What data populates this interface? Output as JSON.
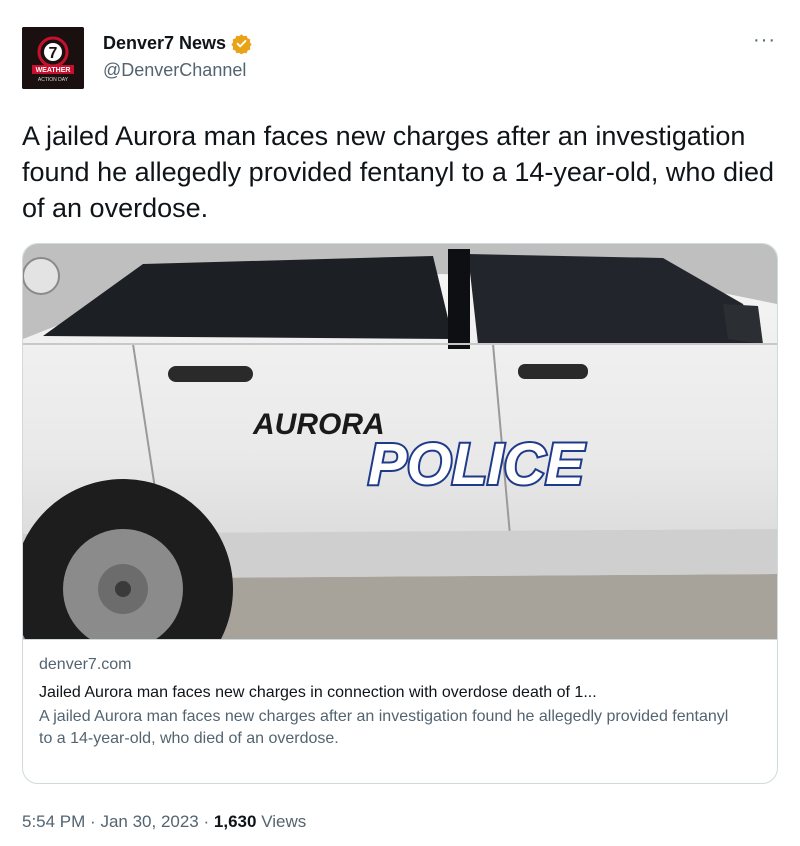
{
  "account": {
    "display_name": "Denver7 News",
    "handle": "@DenverChannel",
    "avatar": {
      "label_number": "7",
      "label_line1": "WEATHER",
      "label_line2": "ACTION DAY"
    }
  },
  "menu": {
    "more_label": "···"
  },
  "tweet": {
    "text": "A jailed Aurora man faces new charges after an investigation found he allegedly provided fentanyl to a 14-year-old, who died of an overdose."
  },
  "link_card": {
    "image": {
      "line1": "AURORA",
      "line2": "POLICE"
    },
    "domain": "denver7.com",
    "title": "Jailed Aurora man faces new charges in connection with overdose death of 1...",
    "description": "A jailed Aurora man faces new charges after an investigation found he allegedly provided fentanyl to a 14-year-old, who died of an overdose."
  },
  "meta": {
    "time": "5:54 PM",
    "separator": "·",
    "date": "Jan 30, 2023",
    "views_count": "1,630",
    "views_label": "Views"
  },
  "colors": {
    "text_primary": "#0f1419",
    "text_secondary": "#536471",
    "border": "#cfd9de",
    "verified_badge": "#e8a317",
    "police_blue": "#1f3a8a"
  },
  "icons": {
    "verified": "verified-badge-icon",
    "more": "more-options-icon"
  }
}
